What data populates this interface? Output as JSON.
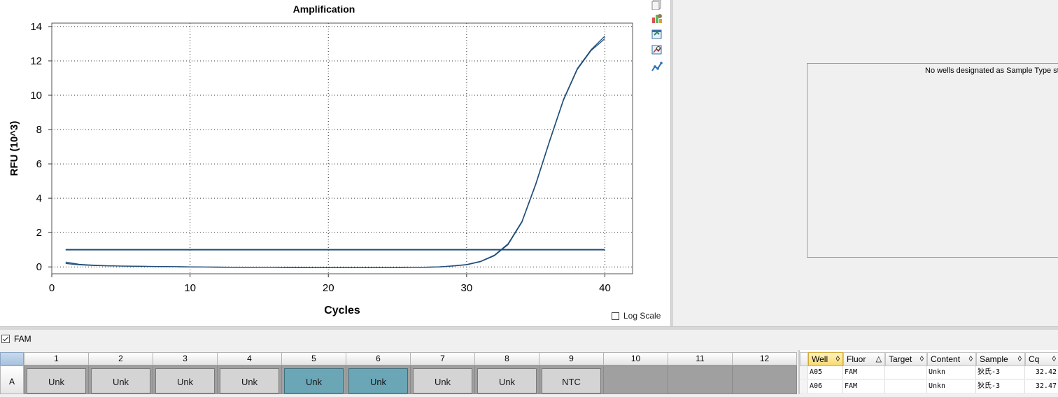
{
  "chart_data": {
    "type": "line",
    "title": "Amplification",
    "xlabel": "Cycles",
    "ylabel": "RFU (10^3)",
    "xlim": [
      0,
      42
    ],
    "ylim": [
      -0.4,
      14.2
    ],
    "xticks": [
      0,
      10,
      20,
      30,
      40
    ],
    "yticks": [
      0,
      2,
      4,
      6,
      8,
      10,
      12,
      14
    ],
    "grid": true,
    "threshold": 1.0,
    "colors": {
      "line": "#1f4e79",
      "threshold": "#1f4e79"
    },
    "series": [
      {
        "x": [
          1,
          2,
          3,
          4,
          5,
          6,
          7,
          8,
          9,
          10,
          11,
          12,
          13,
          14,
          15,
          16,
          17,
          18,
          19,
          20,
          21,
          22,
          23,
          24,
          25,
          26,
          27,
          28,
          29,
          30,
          31,
          32,
          33,
          34,
          35,
          36,
          37,
          38,
          39,
          40
        ],
        "values": [
          0.28,
          0.15,
          0.1,
          0.07,
          0.05,
          0.04,
          0.03,
          0.02,
          0.01,
          0.0,
          -0.01,
          -0.02,
          -0.02,
          -0.03,
          -0.03,
          -0.03,
          -0.04,
          -0.04,
          -0.04,
          -0.04,
          -0.04,
          -0.04,
          -0.04,
          -0.04,
          -0.04,
          -0.03,
          -0.02,
          0.0,
          0.05,
          0.12,
          0.3,
          0.65,
          1.3,
          2.6,
          4.8,
          7.3,
          9.7,
          11.5,
          12.6,
          13.3
        ]
      },
      {
        "x": [
          1,
          2,
          3,
          4,
          5,
          6,
          7,
          8,
          9,
          10,
          11,
          12,
          13,
          14,
          15,
          16,
          17,
          18,
          19,
          20,
          21,
          22,
          23,
          24,
          25,
          26,
          27,
          28,
          29,
          30,
          31,
          32,
          33,
          34,
          35,
          36,
          37,
          38,
          39,
          40
        ],
        "values": [
          0.2,
          0.12,
          0.08,
          0.06,
          0.05,
          0.04,
          0.03,
          0.02,
          0.01,
          0.0,
          -0.01,
          -0.01,
          -0.02,
          -0.02,
          -0.03,
          -0.03,
          -0.03,
          -0.03,
          -0.04,
          -0.04,
          -0.04,
          -0.04,
          -0.04,
          -0.04,
          -0.04,
          -0.03,
          -0.02,
          0.0,
          0.06,
          0.14,
          0.32,
          0.68,
          1.35,
          2.65,
          4.85,
          7.35,
          9.75,
          11.55,
          12.65,
          13.45
        ]
      }
    ]
  },
  "toolbar_icons": [
    "copy-icon",
    "chart-settings-icon",
    "export-icon",
    "zoom-icon",
    "tools-icon"
  ],
  "standard_curve": {
    "message": "No wells designated as Sample Type sta"
  },
  "log_scale": {
    "label": "Log Scale",
    "checked": false
  },
  "fluor_filter": {
    "label": "FAM",
    "checked": true
  },
  "plate": {
    "columns": [
      "1",
      "2",
      "3",
      "4",
      "5",
      "6",
      "7",
      "8",
      "9",
      "10",
      "11",
      "12"
    ],
    "row_label": "A",
    "wells": [
      {
        "label": "Unk",
        "selected": false
      },
      {
        "label": "Unk",
        "selected": false
      },
      {
        "label": "Unk",
        "selected": false
      },
      {
        "label": "Unk",
        "selected": false
      },
      {
        "label": "Unk",
        "selected": true
      },
      {
        "label": "Unk",
        "selected": true
      },
      {
        "label": "Unk",
        "selected": false
      },
      {
        "label": "Unk",
        "selected": false
      },
      {
        "label": "NTC",
        "selected": false
      },
      {
        "label": "",
        "selected": false
      },
      {
        "label": "",
        "selected": false
      },
      {
        "label": "",
        "selected": false
      }
    ],
    "colors": {
      "selected": "#6aa6b6",
      "normal": "#d4d4d4",
      "empty": "#a0a0a0"
    }
  },
  "table": {
    "headers": [
      {
        "label": "Well",
        "sort": "◊"
      },
      {
        "label": "Fluor",
        "sort": "△"
      },
      {
        "label": "Target",
        "sort": "◊"
      },
      {
        "label": "Content",
        "sort": "◊"
      },
      {
        "label": "Sample",
        "sort": "◊"
      },
      {
        "label": "Cq",
        "sort": "◊"
      }
    ],
    "rows": [
      [
        "A05",
        "FAM",
        "",
        "Unkn",
        "狄氏-3",
        "32.42"
      ],
      [
        "A06",
        "FAM",
        "",
        "Unkn",
        "狄氏-3",
        "32.47"
      ]
    ]
  }
}
